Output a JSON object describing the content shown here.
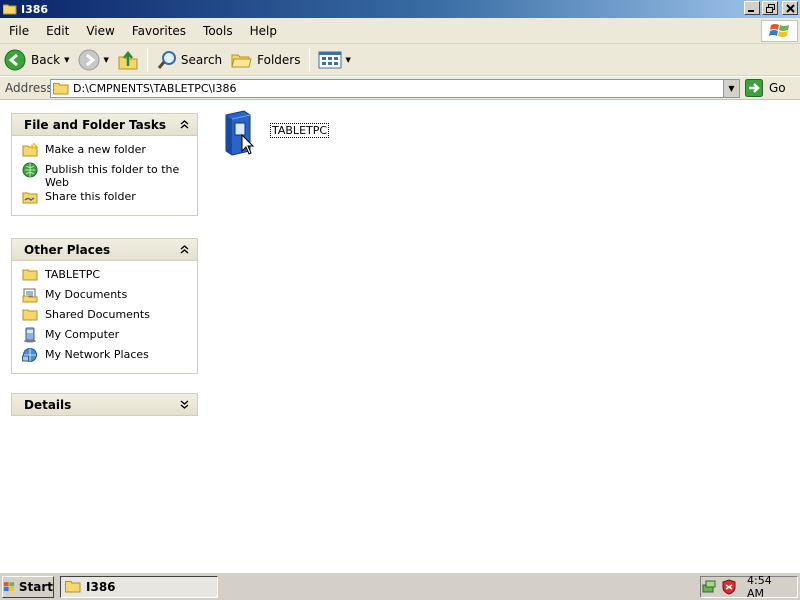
{
  "window": {
    "title": "I386",
    "icon": "folder-icon",
    "controls": [
      "minimize",
      "restore",
      "close"
    ]
  },
  "menubar": {
    "items": [
      "File",
      "Edit",
      "View",
      "Favorites",
      "Tools",
      "Help"
    ]
  },
  "toolbar": {
    "back_label": "Back",
    "search_label": "Search",
    "folders_label": "Folders"
  },
  "address": {
    "label": "Address",
    "value": "D:\\CMPNENTS\\TABLETPC\\I386",
    "go_label": "Go"
  },
  "taskpane": {
    "file_folder_tasks": {
      "title": "File and Folder Tasks",
      "items": [
        {
          "label": "Make a new folder",
          "icon": "new-folder-icon"
        },
        {
          "label": "Publish this folder to the Web",
          "icon": "publish-web-icon"
        },
        {
          "label": "Share this folder",
          "icon": "share-folder-icon"
        }
      ]
    },
    "other_places": {
      "title": "Other Places",
      "items": [
        {
          "label": "TABLETPC",
          "icon": "folder-icon"
        },
        {
          "label": "My Documents",
          "icon": "my-documents-icon"
        },
        {
          "label": "Shared Documents",
          "icon": "folder-icon"
        },
        {
          "label": "My Computer",
          "icon": "my-computer-icon"
        },
        {
          "label": "My Network Places",
          "icon": "network-places-icon"
        }
      ]
    },
    "details": {
      "title": "Details"
    }
  },
  "content": {
    "items": [
      {
        "label": "TABLETPC",
        "icon": "setup-installer-icon",
        "selected": true
      }
    ]
  },
  "taskbar": {
    "start_label": "Start",
    "task_label": "I386",
    "clock": "4:54 AM"
  },
  "colors": {
    "titlebar_start": "#0a246a",
    "titlebar_end": "#a6caf0",
    "chrome": "#ece9d8"
  }
}
